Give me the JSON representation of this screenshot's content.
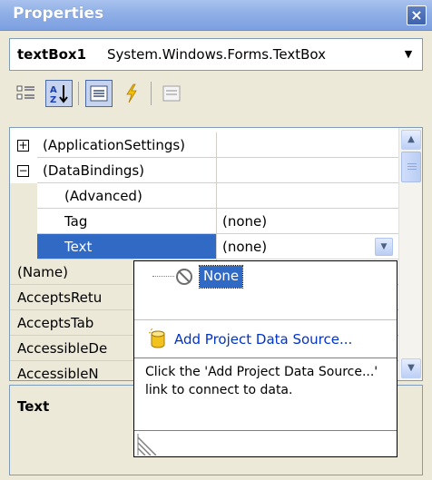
{
  "window": {
    "title": "Properties",
    "close_label": "×"
  },
  "object_selector": {
    "name": "textBox1",
    "type": "System.Windows.Forms.TextBox"
  },
  "toolbar": {
    "buttons": [
      {
        "icon": "categorized-icon",
        "pressed": false
      },
      {
        "icon": "alphabetical-icon",
        "pressed": true,
        "glyph": "A↓"
      },
      {
        "icon": "properties-icon",
        "pressed": true
      },
      {
        "icon": "events-icon",
        "pressed": false,
        "glyph": "⚡"
      },
      {
        "icon": "property-pages-icon",
        "pressed": false
      }
    ]
  },
  "grid": {
    "rows": [
      {
        "name": "(ApplicationSettings)",
        "value": "",
        "expander": "+",
        "kind": "category"
      },
      {
        "name": "(DataBindings)",
        "value": "",
        "expander": "−",
        "kind": "category"
      },
      {
        "name": "(Advanced)",
        "value": "",
        "kind": "child"
      },
      {
        "name": "Tag",
        "value": "(none)",
        "kind": "child"
      },
      {
        "name": "Text",
        "value": "(none)",
        "kind": "child",
        "selected": true
      },
      {
        "name": "(Name)",
        "value": "",
        "kind": "top"
      },
      {
        "name": "AcceptsRetu",
        "value": "",
        "kind": "top"
      },
      {
        "name": "AcceptsTab",
        "value": "",
        "kind": "top"
      },
      {
        "name": "AccessibleDe",
        "value": "",
        "kind": "top"
      },
      {
        "name": "AccessibleN",
        "value": "",
        "kind": "top"
      }
    ]
  },
  "description": {
    "title": "Text"
  },
  "popup": {
    "none_label": "None",
    "add_source_label": "Add Project Data Source...",
    "help_text": "Click the 'Add Project Data Source...' link to connect to data."
  },
  "colors": {
    "selection": "#316ac5",
    "titlebar": "#8fafe6",
    "link": "#0033cc"
  }
}
